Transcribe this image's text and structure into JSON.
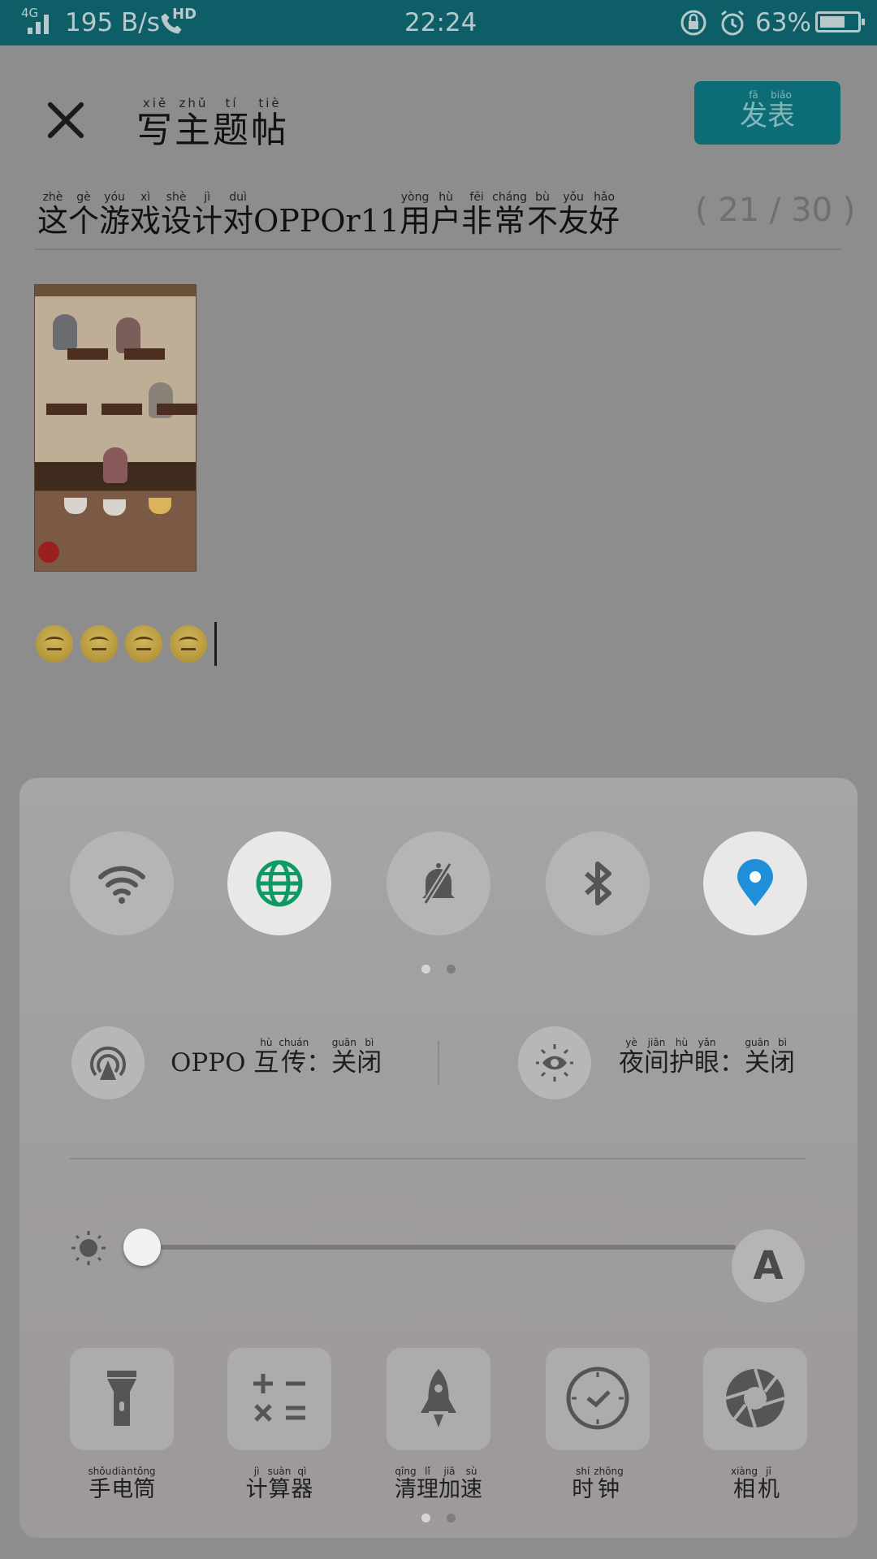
{
  "status_bar": {
    "network": "4G",
    "speed": "195 B/s",
    "hd": "HD",
    "time": "22:24",
    "battery": "63%"
  },
  "header": {
    "title": [
      {
        "ch": "写",
        "py": "xiě"
      },
      {
        "ch": "主",
        "py": "zhǔ"
      },
      {
        "ch": "题",
        "py": "tí"
      },
      {
        "ch": "帖",
        "py": "tiè"
      }
    ],
    "publish": [
      {
        "ch": "发",
        "py": "fā"
      },
      {
        "ch": "表",
        "py": "biǎo"
      }
    ]
  },
  "post": {
    "title": [
      {
        "ch": "这",
        "py": "zhè"
      },
      {
        "ch": "个",
        "py": "gè"
      },
      {
        "ch": "游",
        "py": "yóu"
      },
      {
        "ch": "戏",
        "py": "xì"
      },
      {
        "ch": "设",
        "py": "shè"
      },
      {
        "ch": "计",
        "py": "jì"
      },
      {
        "ch": "对",
        "py": "duì"
      },
      {
        "ch": "OPPOr11",
        "py": ""
      },
      {
        "ch": "用",
        "py": "yòng"
      },
      {
        "ch": "户",
        "py": "hù"
      },
      {
        "ch": "非",
        "py": "fēi"
      },
      {
        "ch": "常",
        "py": "cháng"
      },
      {
        "ch": "不",
        "py": "bù"
      },
      {
        "ch": "友",
        "py": "yǒu"
      },
      {
        "ch": "好",
        "py": "hǎo"
      }
    ],
    "char_count": "( 21 / 30 )",
    "emoji_count": 4
  },
  "quick_panel": {
    "toggles": [
      {
        "name": "wifi-toggle",
        "icon": "wifi-icon",
        "on": false
      },
      {
        "name": "mobile-data-toggle",
        "icon": "globe-icon",
        "on": true
      },
      {
        "name": "mute-toggle",
        "icon": "bell-off-icon",
        "on": false
      },
      {
        "name": "bluetooth-toggle",
        "icon": "bluetooth-icon",
        "on": false
      },
      {
        "name": "location-toggle",
        "icon": "location-pin-icon",
        "on": true
      }
    ],
    "share": {
      "prefix": "OPPO",
      "label": [
        {
          "ch": "互",
          "py": "hù"
        },
        {
          "ch": "传",
          "py": "chuán"
        },
        {
          "ch": "：",
          "py": ""
        },
        {
          "ch": "关",
          "py": "guān"
        },
        {
          "ch": "闭",
          "py": "bì"
        }
      ]
    },
    "night_mode": {
      "label": [
        {
          "ch": "夜",
          "py": "yè"
        },
        {
          "ch": "间",
          "py": "jiān"
        },
        {
          "ch": "护",
          "py": "hù"
        },
        {
          "ch": "眼",
          "py": "yǎn"
        },
        {
          "ch": "：",
          "py": ""
        },
        {
          "ch": "关",
          "py": "guān"
        },
        {
          "ch": "闭",
          "py": "bì"
        }
      ]
    },
    "brightness": {
      "level": 0.02,
      "auto_label": "A"
    },
    "tools": [
      {
        "name": "flashlight",
        "icon": "flashlight-icon",
        "label": [
          {
            "ch": "手",
            "py": "shǒu"
          },
          {
            "ch": "电",
            "py": "diàn"
          },
          {
            "ch": "筒",
            "py": "tǒng"
          }
        ]
      },
      {
        "name": "calculator",
        "icon": "calculator-icon",
        "label": [
          {
            "ch": "计",
            "py": "jì"
          },
          {
            "ch": "算",
            "py": "suàn"
          },
          {
            "ch": "器",
            "py": "qì"
          }
        ]
      },
      {
        "name": "cleanup-boost",
        "icon": "rocket-icon",
        "label": [
          {
            "ch": "清",
            "py": "qīng"
          },
          {
            "ch": "理",
            "py": "lǐ"
          },
          {
            "ch": "加",
            "py": "jiā"
          },
          {
            "ch": "速",
            "py": "sù"
          }
        ]
      },
      {
        "name": "clock",
        "icon": "clock-icon",
        "label": [
          {
            "ch": "时",
            "py": "shí"
          },
          {
            "ch": "钟",
            "py": "zhōng"
          }
        ]
      },
      {
        "name": "camera",
        "icon": "camera-aperture-icon",
        "label": [
          {
            "ch": "相",
            "py": "xiàng"
          },
          {
            "ch": "机",
            "py": "jī"
          }
        ]
      }
    ],
    "pager": {
      "pages": 2,
      "current": 1
    }
  }
}
